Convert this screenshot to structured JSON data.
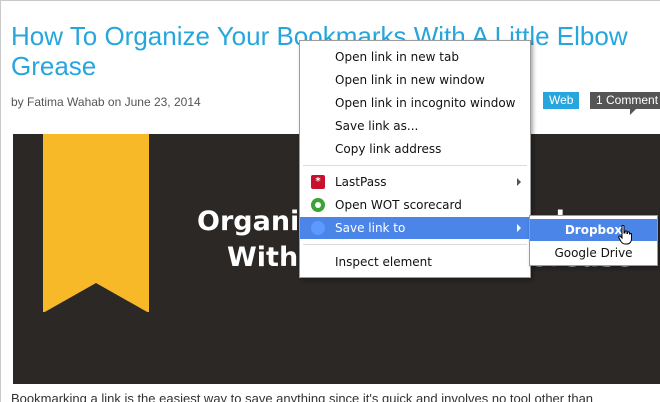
{
  "article": {
    "title": "How To Organize Your Bookmarks With A Little Elbow Grease",
    "byline": "by Fatima Wahab on June 23, 2014",
    "tag": "Web",
    "comments": "1 Comment",
    "hero_line1": "Organize Your Bookmarks",
    "hero_line2": "With A Little Elbow Grease",
    "body_text": "Bookmarking a link is the easiest way to save anything since it's quick and involves no tool other than"
  },
  "context_menu": {
    "items": [
      {
        "label": "Open link in new tab"
      },
      {
        "label": "Open link in new window"
      },
      {
        "label": "Open link in incognito window"
      },
      {
        "label": "Save link as..."
      },
      {
        "label": "Copy link address"
      },
      {
        "label": "LastPass",
        "icon": "lastpass-icon",
        "submenu": true
      },
      {
        "label": "Open WOT scorecard",
        "icon": "wot-icon"
      },
      {
        "label": "Save link to",
        "icon": "save-to-icon",
        "submenu": true,
        "active": true
      },
      {
        "label": "Inspect element"
      }
    ]
  },
  "submenu": {
    "items": [
      {
        "label": "Dropbox",
        "active": true
      },
      {
        "label": "Google Drive"
      }
    ]
  },
  "colors": {
    "accent": "#27a6dd",
    "menu_highlight": "#4c85e8",
    "ribbon": "#f7b928",
    "hero_bg": "#2b2826"
  }
}
